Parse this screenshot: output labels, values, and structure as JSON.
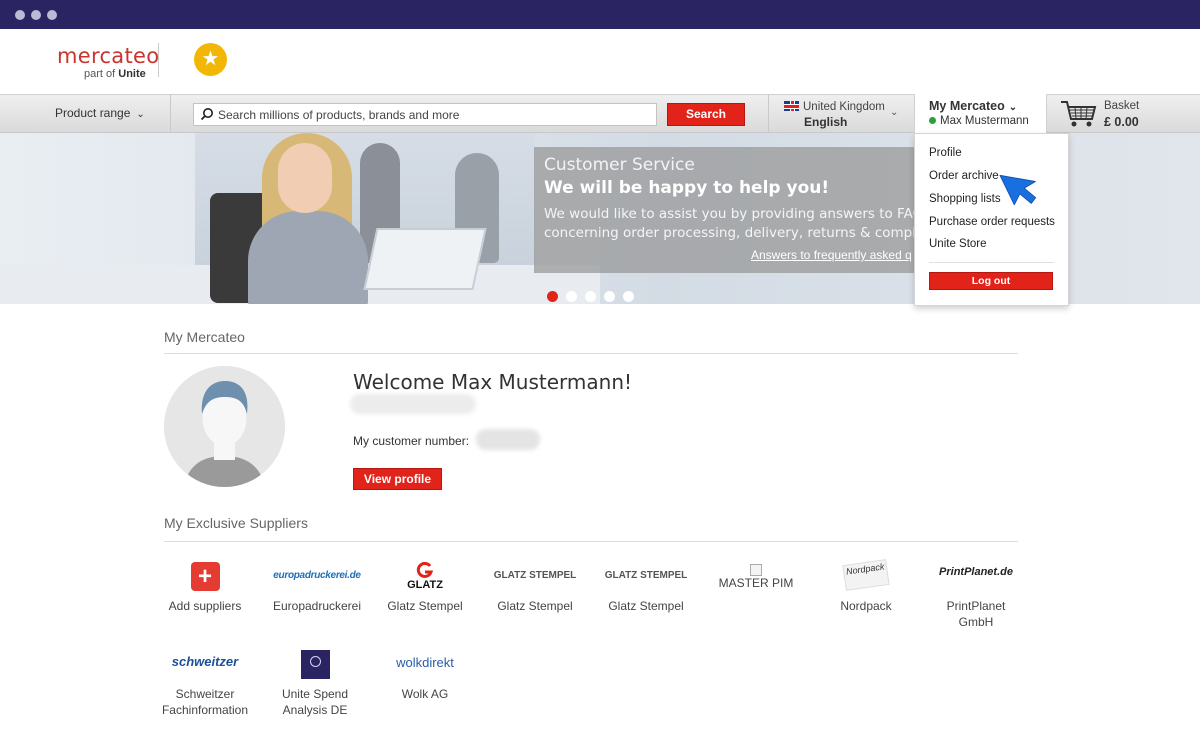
{
  "brand": {
    "logo_word": "mercateo",
    "logo_sub_prefix": "part of",
    "logo_sub_brand": "Unite"
  },
  "nav": {
    "product_range": "Product range",
    "search_placeholder": "Search millions of products, brands and more",
    "search_button": "Search",
    "country": "United Kingdom",
    "language": "English",
    "my_mercateo": "My Mercateo",
    "user_name": "Max Mustermann",
    "basket_label": "Basket",
    "basket_amount": "£ 0.00"
  },
  "banner": {
    "heading": "Customer Service",
    "subheading": "We will be happy to help you!",
    "text": "We would like to assist you by providing answers to FAQs\nconcerning order processing, delivery, returns & complaints",
    "link": "Answers to frequently asked questions",
    "slides": 5,
    "active_slide": 1
  },
  "dropdown": {
    "items": [
      "Profile",
      "Order archive",
      "Shopping lists",
      "Purchase order requests",
      "Unite Store"
    ],
    "logout": "Log out"
  },
  "account": {
    "section_title": "My Mercateo",
    "welcome": "Welcome Max Mustermann!",
    "customer_number_label": "My customer number:",
    "view_profile": "View profile"
  },
  "suppliers": {
    "section_title": "My Exclusive Suppliers",
    "items": [
      {
        "name": "Add suppliers",
        "logo": "+"
      },
      {
        "name": "Europadruckerei",
        "logo": "europadruckerei.de"
      },
      {
        "name": "Glatz Stempel",
        "logo": "GLATZ"
      },
      {
        "name": "Glatz Stempel",
        "logo": "GLATZ STEMPEL"
      },
      {
        "name": "Glatz Stempel",
        "logo": "GLATZ STEMPEL"
      },
      {
        "name": "",
        "logo": "MASTER PIM"
      },
      {
        "name": "Nordpack",
        "logo": "Nordpack"
      },
      {
        "name": "PrintPlanet\nGmbH",
        "logo": "PrintPlanet.de"
      },
      {
        "name": "Schweitzer\nFachinformation",
        "logo": "schweitzer"
      },
      {
        "name": "Unite Spend\nAnalysis DE",
        "logo": ""
      },
      {
        "name": "Wolk AG",
        "logo": "wolkdirekt"
      }
    ]
  },
  "colors": {
    "accent_red": "#e2231a",
    "chrome_bar": "#2b2463",
    "star_gold": "#f2b705",
    "cursor_blue": "#1a6fe0"
  }
}
